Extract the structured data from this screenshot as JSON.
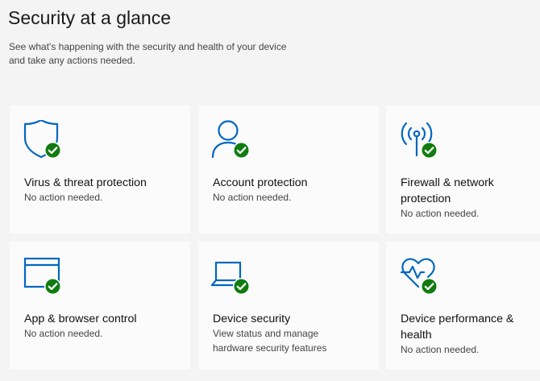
{
  "page": {
    "title": "Security at a glance",
    "subtitle_line1": "See what's happening with the security and health of your device",
    "subtitle_line2": "and take any actions needed."
  },
  "colors": {
    "accent": "#0067c0",
    "ok": "#107c10",
    "card": "#fbfbfb",
    "background": "#f4f4f4"
  },
  "cards": [
    {
      "icon": "shield-icon",
      "title_line1": "Virus & threat protection",
      "title_line2": "",
      "status_line1": "No action needed.",
      "status_line2": ""
    },
    {
      "icon": "person-icon",
      "title_line1": "Account protection",
      "title_line2": "",
      "status_line1": "No action needed.",
      "status_line2": ""
    },
    {
      "icon": "wireless-antenna-icon",
      "title_line1": "Firewall & network",
      "title_line2": "protection",
      "status_line1": "No action needed.",
      "status_line2": ""
    },
    {
      "icon": "browser-window-icon",
      "title_line1": "App & browser control",
      "title_line2": "",
      "status_line1": "No action needed.",
      "status_line2": ""
    },
    {
      "icon": "laptop-icon",
      "title_line1": "Device security",
      "title_line2": "",
      "status_line1": "View status and manage",
      "status_line2": "hardware security features"
    },
    {
      "icon": "heart-pulse-icon",
      "title_line1": "Device performance &",
      "title_line2": "health",
      "status_line1": "No action needed.",
      "status_line2": ""
    }
  ]
}
